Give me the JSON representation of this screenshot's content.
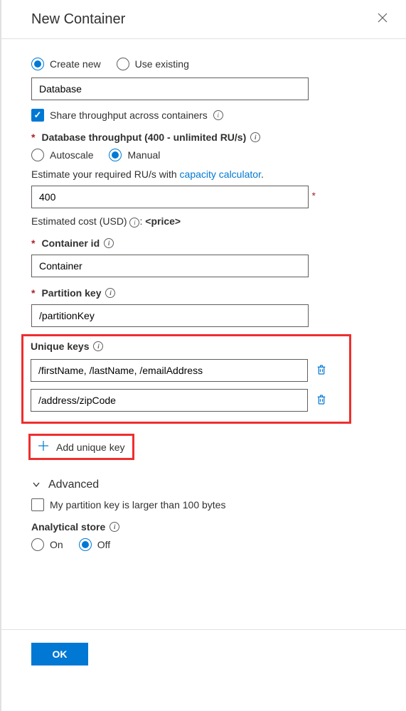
{
  "header": {
    "title": "New Container"
  },
  "database_mode": {
    "create_new_label": "Create new",
    "use_existing_label": "Use existing",
    "selected": "create_new",
    "database_name_value": "Database"
  },
  "share_throughput": {
    "label": "Share throughput across containers",
    "checked": true
  },
  "throughput": {
    "section_label": "Database throughput (400 - unlimited RU/s)",
    "autoscale_label": "Autoscale",
    "manual_label": "Manual",
    "selected": "manual",
    "estimate_prefix": "Estimate your required RU/s with ",
    "estimate_link": "capacity calculator",
    "estimate_suffix": ".",
    "value": "400",
    "cost_label_prefix": "Estimated cost (USD) ",
    "cost_label_suffix": ": ",
    "cost_value": "<price>"
  },
  "container_id": {
    "label": "Container id",
    "value": "Container"
  },
  "partition_key": {
    "label": "Partition key",
    "value": "/partitionKey"
  },
  "unique_keys": {
    "label": "Unique keys",
    "items": [
      "/firstName, /lastName, /emailAddress",
      "/address/zipCode"
    ],
    "add_label": "Add unique key"
  },
  "advanced": {
    "label": "Advanced",
    "large_pk_label": "My partition key is larger than 100 bytes",
    "large_pk_checked": false
  },
  "analytical_store": {
    "label": "Analytical store",
    "on_label": "On",
    "off_label": "Off",
    "selected": "off"
  },
  "footer": {
    "ok_label": "OK"
  }
}
